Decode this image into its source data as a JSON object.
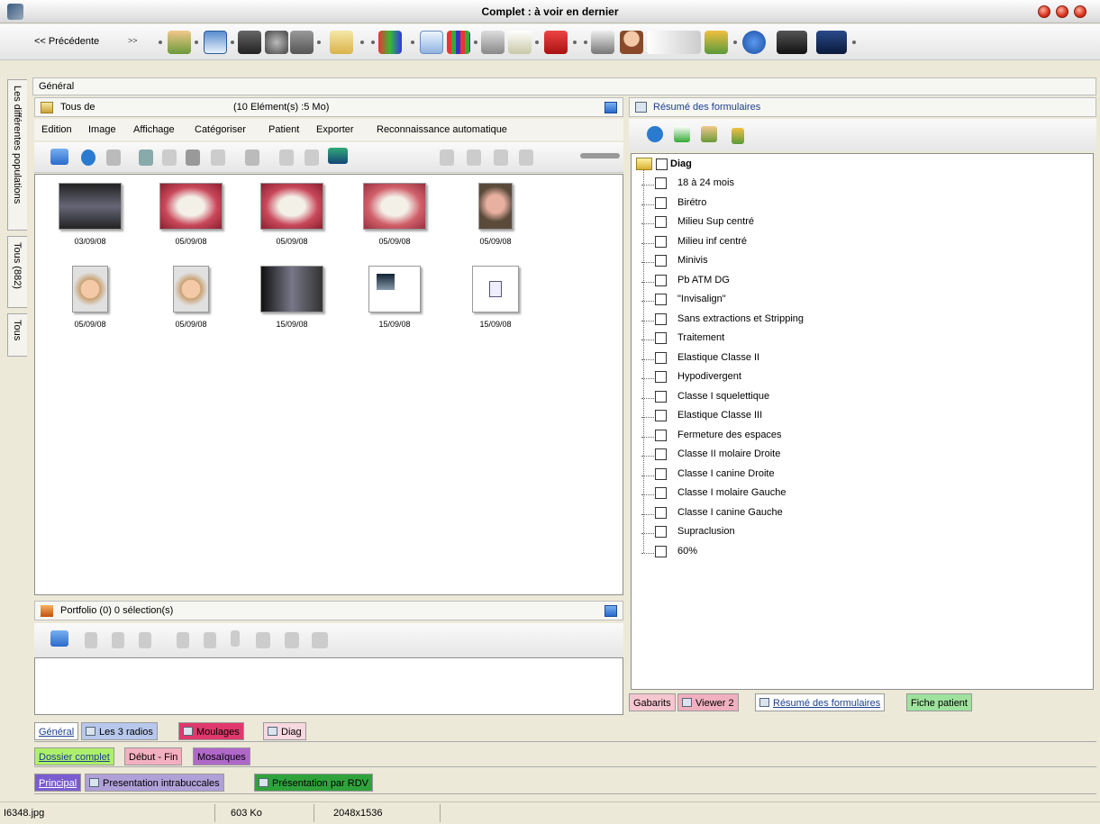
{
  "window": {
    "title": "Complet : à voir en dernier"
  },
  "toolbar": {
    "previous_label": "<< Précédente",
    "next_label": ">>"
  },
  "left_tabs": [
    "Les différentes populations",
    "Tous (882)",
    "Tous"
  ],
  "general_header": "Général",
  "images_panel": {
    "title": "Tous de",
    "count": "(10 Elément(s) :5 Mo)",
    "menu": [
      "Edition",
      "Image",
      "Affichage",
      "Catégoriser",
      "Patient",
      "Exporter",
      "Reconnaissance automatique"
    ],
    "thumbnails": [
      {
        "date": "03/09/08",
        "kind": "xray-pano"
      },
      {
        "date": "05/09/08",
        "kind": "teeth"
      },
      {
        "date": "05/09/08",
        "kind": "teeth"
      },
      {
        "date": "05/09/08",
        "kind": "teeth"
      },
      {
        "date": "05/09/08",
        "kind": "profile"
      },
      {
        "date": "05/09/08",
        "kind": "face"
      },
      {
        "date": "05/09/08",
        "kind": "face"
      },
      {
        "date": "15/09/08",
        "kind": "xray-ceph"
      },
      {
        "date": "15/09/08",
        "kind": "document-chart"
      },
      {
        "date": "15/09/08",
        "kind": "document-icon"
      }
    ]
  },
  "portfolio_panel": {
    "title": "Portfolio (0) 0 sélection(s)"
  },
  "forms_panel": {
    "title": "Résumé des formulaires",
    "root": "Diag",
    "items": [
      "18 à 24 mois",
      "Birétro",
      "Milieu Sup centré",
      "Milieu inf centré",
      "Minivis",
      "Pb ATM DG",
      "\"Invisalign\"",
      "Sans extractions et Stripping",
      "Traitement",
      "Elastique Classe II",
      "Hypodivergent",
      "Classe I squelettique",
      "Elastique Classe III",
      "Fermeture des espaces",
      "Classe II molaire Droite",
      "Classe I canine Droite",
      "Classe I molaire Gauche",
      "Classe I canine Gauche",
      "Supraclusion",
      "60%"
    ],
    "bottom_tabs": [
      "Gabarits",
      "Viewer 2",
      "Résumé des formulaires",
      "Fiche patient"
    ]
  },
  "tabs_row1": [
    "Général",
    "Les 3 radios",
    "Moulages",
    "Diag"
  ],
  "tabs_row2": [
    "Dossier complet",
    "Début - Fin",
    "Mosaïques"
  ],
  "tabs_row3": [
    "Principal",
    "Presentation intrabuccales",
    "Présentation par RDV"
  ],
  "status": {
    "filename": "I6348.jpg",
    "size": "603 Ko",
    "dimensions": "2048x1536"
  }
}
